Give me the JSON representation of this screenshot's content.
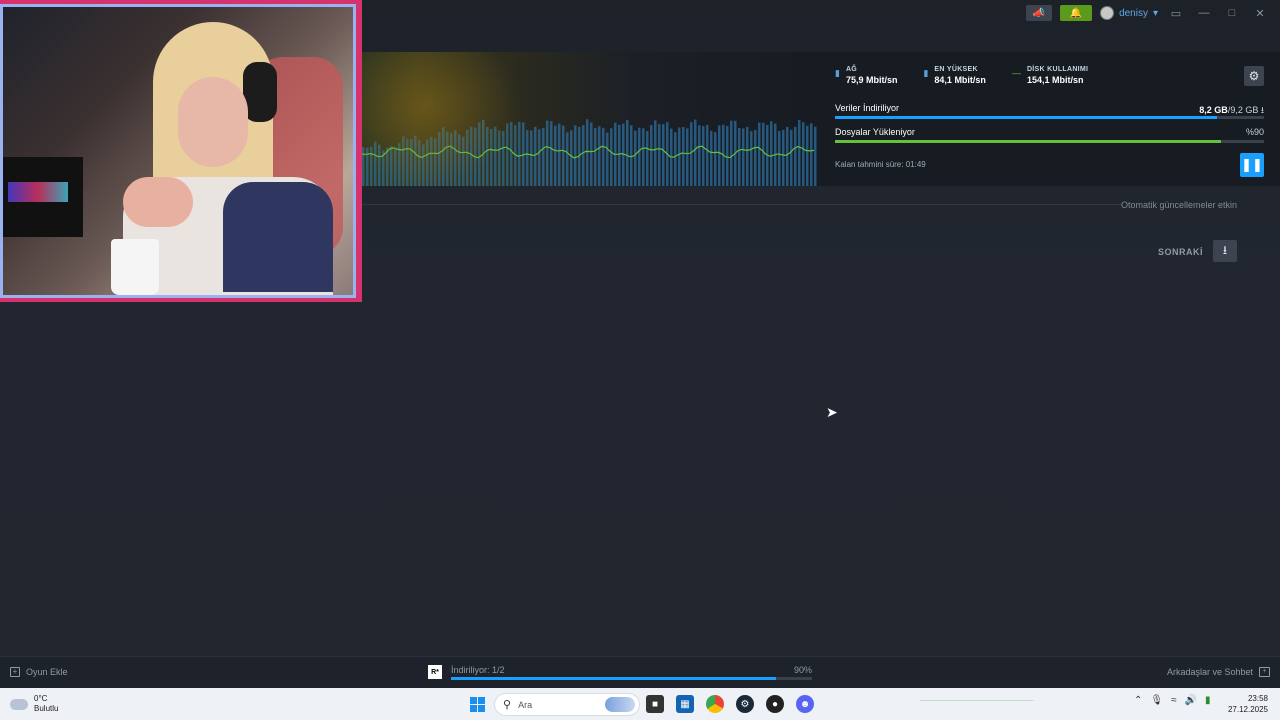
{
  "titlebar": {
    "username": "denisy",
    "icons": [
      "megaphone-icon",
      "bell-icon",
      "monitor-icon",
      "minimize-icon",
      "maximize-icon",
      "close-icon"
    ]
  },
  "stats": [
    {
      "label": "AĞ",
      "value": "75,9 Mbit/sn",
      "icon": "bars-icon"
    },
    {
      "label": "EN YÜKSEK",
      "value": "84,1 Mbit/sn",
      "icon": "bars-icon"
    },
    {
      "label": "DİSK KULLANIMI",
      "value": "154,1 Mbit/sn",
      "icon": "line-icon"
    }
  ],
  "download": {
    "row1_label": "Veriler İndiriliyor",
    "row1_done": "8,2 GB",
    "row1_total": "/9,2 GB",
    "row1_progress": 0.89,
    "row2_label": "Dosyalar Yükleniyor",
    "row2_pct": "%90",
    "row2_progress": 0.9,
    "eta": "Kalan tahmini süre: 01:49"
  },
  "body": {
    "auto_updates": "Otomatik güncellemeler etkin",
    "next_label": "SONRAKİ"
  },
  "bottom": {
    "add_game": "Oyun Ekle",
    "dl_game_icon": "R*",
    "dl_text": "İndiriliyor: 1/2",
    "dl_pct": "90%",
    "dl_progress": 0.9,
    "friends": "Arkadaşlar ve Sohbet"
  },
  "taskbar": {
    "temp": "0°C",
    "weather": "Bulutlu",
    "search_placeholder": "Ara",
    "time": "23:58",
    "date": "27.12.2025"
  },
  "colors": {
    "accent": "#1a9fff",
    "green": "#63c13a",
    "webcam_frame": "#d6326e"
  }
}
